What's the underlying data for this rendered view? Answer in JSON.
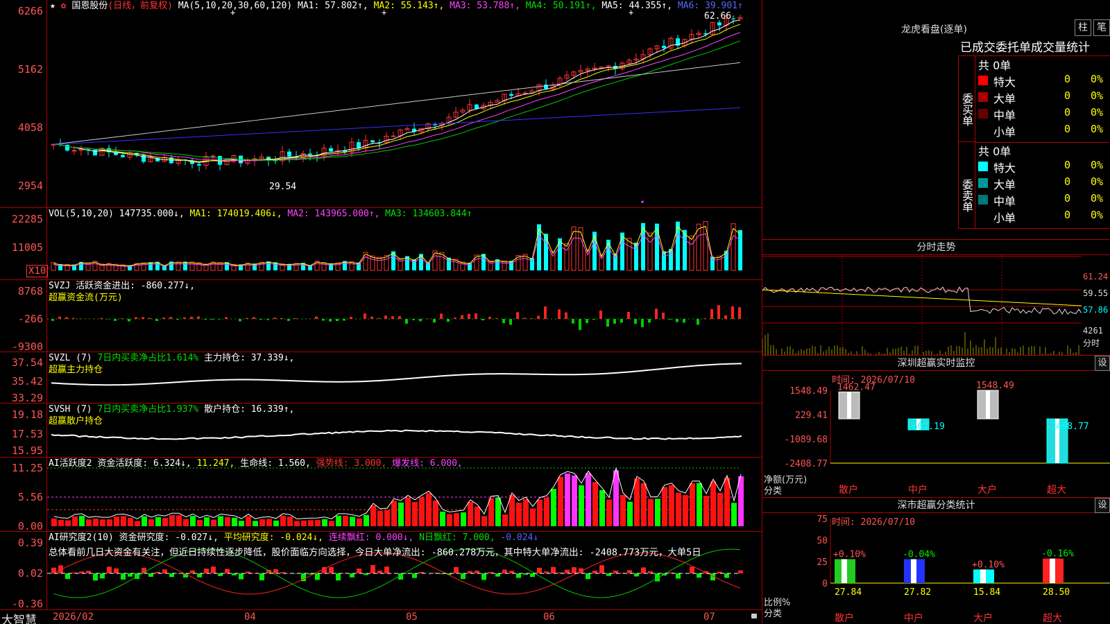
{
  "main": {
    "star": "★",
    "gear": "✿",
    "stock_name": "国恩股份",
    "mode": "(日线，前复权)",
    "ma_params": "MA(5,10,20,30,60,120)",
    "ma1": "MA1: 57.802↑,",
    "ma2": "MA2: 55.143↑,",
    "ma3": "MA3: 53.788↑,",
    "ma4": "MA4: 50.191↑,",
    "ma5": "MA5: 44.355↑,",
    "ma6": "MA6: 39.901↑",
    "yticks": [
      "6266",
      "5162",
      "4058",
      "2954"
    ],
    "high_label": "62.66",
    "low_label": "29.54",
    "arrow_label": "◂"
  },
  "vol": {
    "title": "VOL(5,10,20)",
    "value": "147735.000↓,",
    "ma1": "MA1: 174019.406↓,",
    "ma2": "MA2: 143965.000↑,",
    "ma3": "MA3: 134603.844↑",
    "yticks": [
      "22285",
      "11005"
    ],
    "unit": "X10"
  },
  "svzj": {
    "title": "SVZJ",
    "desc": "活跃资金进出: -860.277↓,",
    "name": "超赢资金流(万元)",
    "yticks": [
      "8768",
      "-266",
      "-9300"
    ]
  },
  "svzl": {
    "title": "SVZL (7)",
    "seven": "7日内买卖净占比1.614%",
    "hold": "主力持仓: 37.339↓,",
    "name": "超赢主力持仓",
    "yticks": [
      "37.54",
      "35.42",
      "33.29"
    ]
  },
  "svsh": {
    "title": "SVSH (7)",
    "seven": "7日内买卖净占比1.937%",
    "hold": "散户持仓: 16.339↑,",
    "name": "超赢散户持仓",
    "yticks": [
      "19.18",
      "17.53",
      "15.95"
    ]
  },
  "ai1": {
    "title": "AI活跃度2",
    "d1": "资金活跃度: 6.324↓,",
    "d2": "11.247,",
    "d3": "生命线: 1.560,",
    "d4": "强势线: 3.000,",
    "d5": "爆发线: 6.000,",
    "yticks": [
      "11.25",
      "5.56",
      "0.00"
    ]
  },
  "ai2": {
    "title": "AI研究度2(10)",
    "d1": "资金研究度: -0.027↓,",
    "d2": "平均研究度: -0.024↓,",
    "d3": "连续飘红: 0.000↓,",
    "d4": "N日飘红: 7.000,",
    "d5": "-0.024↓",
    "text": "总体看前几日大资金有关注，但近日持续性逐步降低，股价面临方向选择，今日大单净流出: -860.278万元，其中特大单净流出: -2408.773万元，大单5日",
    "yticks": [
      "0.39",
      "0.02",
      "-0.36"
    ]
  },
  "xaxis": {
    "brand": "大智慧",
    "labels": [
      "2026/02",
      "04",
      "05",
      "06",
      "07"
    ]
  },
  "lhb": {
    "title": "龙虎看盘(逐单)",
    "btn1": "柱",
    "btn2": "笔",
    "header": "已成交委托单成交量统计",
    "buy_label": "委买单",
    "sell_label": "委卖单",
    "buy_total": "共 0单",
    "sell_total": "共 0单",
    "rows": [
      {
        "name": "特大",
        "num": "0",
        "pct": "0%"
      },
      {
        "name": "大单",
        "num": "0",
        "pct": "0%"
      },
      {
        "name": "中单",
        "num": "0",
        "pct": "0%"
      },
      {
        "name": "小单",
        "num": "0",
        "pct": "0%"
      }
    ],
    "buy_colors": [
      "#ff0000",
      "#aa0000",
      "#660000",
      ""
    ],
    "sell_colors": [
      "#00ffff",
      "#009999",
      "#007777",
      ""
    ]
  },
  "fenshi": {
    "title": "分时走势",
    "yticks": [
      "61.24",
      "59.55",
      "57.86"
    ],
    "vol_top": "4261",
    "vol_label": "分时"
  },
  "sz": {
    "title": "深圳超赢实时监控",
    "btn": "设",
    "time": "时间: 2026/07/10",
    "yticks": [
      "1548.49",
      "229.41",
      "-1089.68",
      "-2408.77"
    ],
    "ylabel1": "净额(万元)",
    "ylabel2": "分类",
    "cats": [
      "散户",
      "中户",
      "大户",
      "超大"
    ],
    "values": [
      1462.47,
      -602.19,
      1548.49,
      -2408.77
    ],
    "labels": [
      "1462.47",
      "-602.19",
      "1548.49",
      "-2408.77"
    ]
  },
  "fl": {
    "title": "深市超赢分类统计",
    "btn": "设",
    "time": "时间: 2026/07/10",
    "yticks": [
      "75",
      "50",
      "25",
      "0"
    ],
    "ylabel1": "比例%",
    "ylabel2": "分类",
    "cats": [
      "散户",
      "中户",
      "大户",
      "超大"
    ],
    "values": [
      27.84,
      27.82,
      15.84,
      28.5
    ],
    "vlabels": [
      "27.84",
      "27.82",
      "15.84",
      "28.50"
    ],
    "chg": [
      "+0.10%",
      "-0.04%",
      "+0.10%",
      "-0.16%"
    ],
    "colors": [
      "#22cc22",
      "#2233ff",
      "#00ffff",
      "#ff2222"
    ]
  },
  "chart_data": {
    "type": "bar",
    "title": "深圳超赢实时监控",
    "categories": [
      "散户",
      "中户",
      "大户",
      "超大"
    ],
    "series": [
      {
        "name": "净额(万元)",
        "values": [
          1462.47,
          -602.19,
          1548.49,
          -2408.77
        ]
      },
      {
        "name": "比例%",
        "values": [
          27.84,
          27.82,
          15.84,
          28.5
        ]
      }
    ]
  }
}
